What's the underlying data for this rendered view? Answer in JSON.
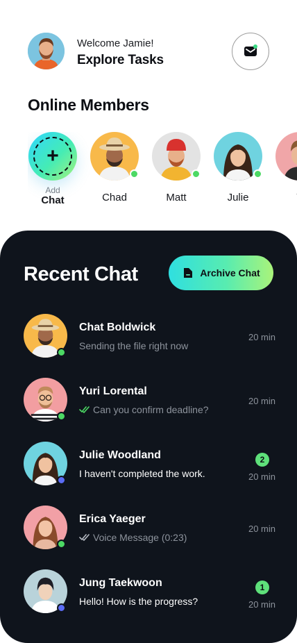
{
  "header": {
    "welcome": "Welcome Jamie!",
    "subtitle": "Explore Tasks",
    "mail_icon": "mail-icon"
  },
  "online": {
    "title": "Online Members",
    "add": {
      "small": "Add",
      "big": "Chat",
      "icon": "plus-icon"
    },
    "members": [
      {
        "name": "Chad",
        "bg": "#f8b94a"
      },
      {
        "name": "Matt",
        "bg": "#e3e3e3"
      },
      {
        "name": "Julie",
        "bg": "#6fd3e0"
      },
      {
        "name": "Y",
        "bg": "#f0a6a8"
      }
    ]
  },
  "recent": {
    "title": "Recent Chat",
    "archive_label": "Archive Chat",
    "archive_icon": "archive-icon",
    "chats": [
      {
        "name": "Chat Boldwick",
        "message": "Sending the file right now",
        "time": "20 min",
        "read": false,
        "badge": "",
        "status": "#4cd964",
        "bg": "#f8b94a"
      },
      {
        "name": "Yuri Lorental",
        "message": "Can you confirm deadline?",
        "time": "20 min",
        "read": true,
        "badge": "",
        "status": "#4cd964",
        "bg": "#f29ea1"
      },
      {
        "name": "Julie Woodland",
        "message": "I haven't completed the work.",
        "time": "20 min",
        "read": false,
        "badge": "2",
        "status": "#5b6cf5",
        "bg": "#6fd3e0"
      },
      {
        "name": "Erica Yaeger",
        "message": "Voice Message (0:23)",
        "time": "20 min",
        "read": true,
        "badge": "",
        "status": "#4cd964",
        "bg": "#f2a0a6"
      },
      {
        "name": "Jung Taekwoon",
        "message": "Hello! How is the progress?",
        "time": "20 min",
        "read": false,
        "badge": "1",
        "status": "#5b6cf5",
        "bg": "#b9d3da"
      }
    ]
  },
  "colors": {
    "accent_start": "#2fdfe0",
    "accent_end": "#aaf37a",
    "panel": "#0f141c",
    "online": "#4cd964"
  }
}
